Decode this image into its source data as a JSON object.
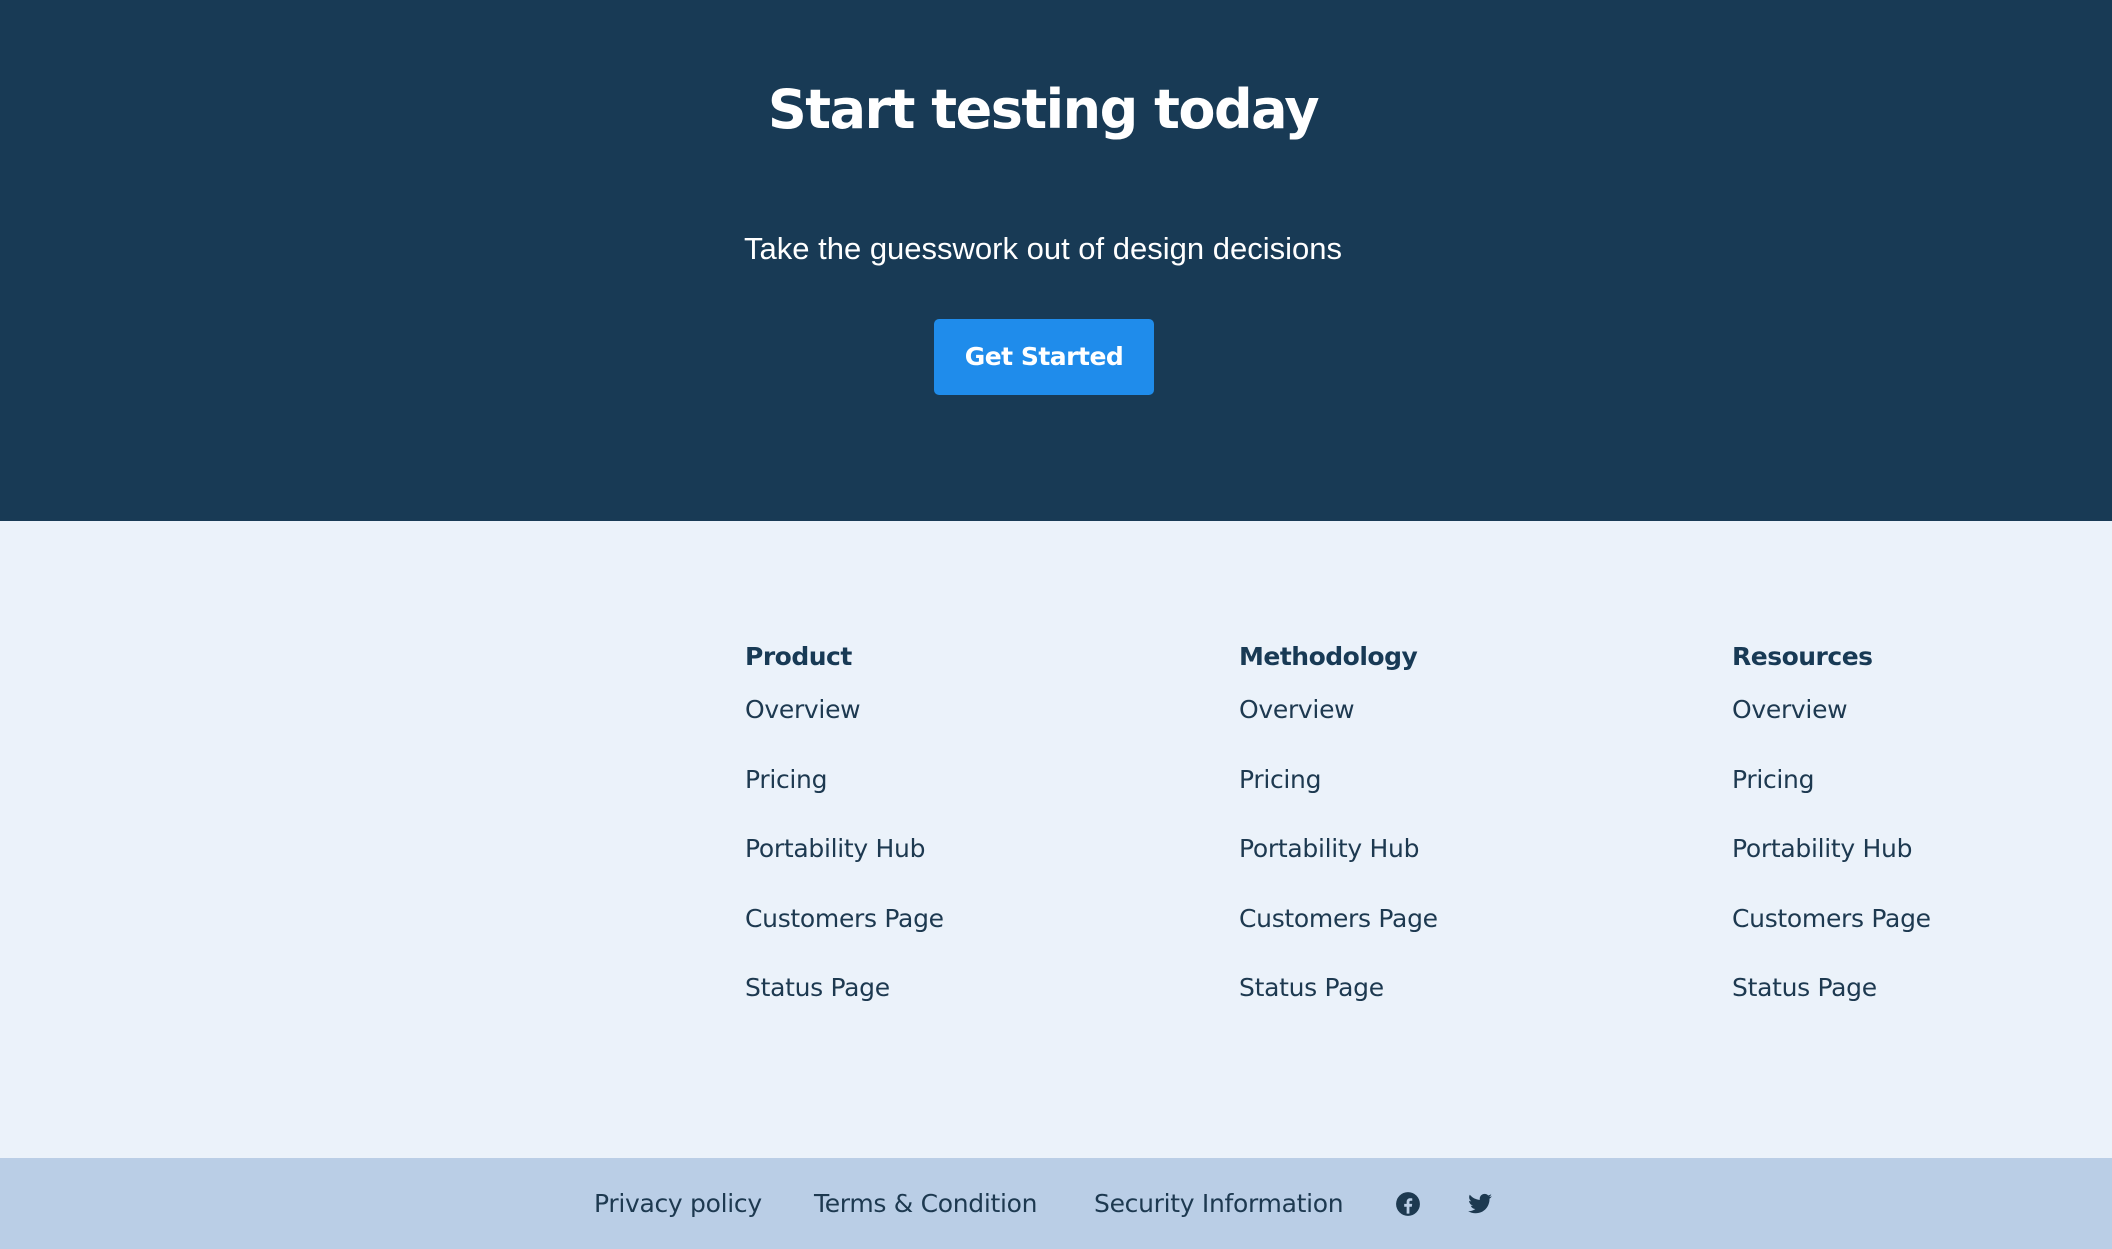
{
  "hero": {
    "title": "Start testing today",
    "subtitle": "Take the guesswork out of design decisions",
    "cta_label": "Get Started"
  },
  "columns": [
    {
      "heading": "Product",
      "links": [
        "Overview",
        "Pricing",
        "Portability Hub",
        "Customers Page",
        "Status Page"
      ]
    },
    {
      "heading": "Methodology",
      "links": [
        "Overview",
        "Pricing",
        "Portability Hub",
        "Customers Page",
        "Status Page"
      ]
    },
    {
      "heading": "Resources",
      "links": [
        "Overview",
        "Pricing",
        "Portability Hub",
        "Customers Page",
        "Status Page"
      ]
    }
  ],
  "footer": {
    "privacy_label": "Privacy policy",
    "terms_label": "Terms & Condition",
    "security_label": "Security Information",
    "social": [
      "facebook-icon",
      "twitter-icon"
    ]
  },
  "colors": {
    "hero_bg": "#183a55",
    "cta_bg": "#1f8ceb",
    "links_bg": "#ebf2fa",
    "footer_bg": "#bacee6",
    "text_dark": "#1d3950"
  }
}
